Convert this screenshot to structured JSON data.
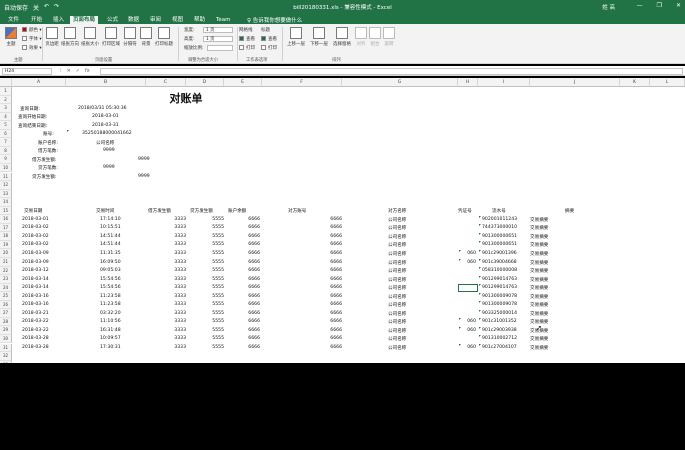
{
  "titlebar": {
    "quick_access": [
      "自动保存",
      "关",
      "↶",
      "↷"
    ],
    "title": "bill20180331.xls - 兼容性模式 - Excel",
    "user": "姓 高",
    "window_buttons": [
      "—",
      "❐",
      "✕"
    ]
  },
  "tabs": [
    "文件",
    "开始",
    "插入",
    "页面布局",
    "公式",
    "数据",
    "审阅",
    "视图",
    "帮助",
    "Team"
  ],
  "active_tab": "页面布局",
  "tellme": "♀ 告诉我你想要做什么",
  "share": "",
  "ribbon": {
    "theme": {
      "theme": "主题",
      "colors": "颜色 ▾",
      "fonts": "字体 ▾",
      "effects": "效果 ▾",
      "label": "主题"
    },
    "page_setup": {
      "margins": "页边距",
      "orientation": "纸张方向",
      "size": "纸张大小",
      "print_area": "打印区域",
      "breaks": "分隔符",
      "background": "背景",
      "print_titles": "打印标题",
      "label": "页面设置"
    },
    "scale": {
      "width_label": "宽度:",
      "width_value": "1 页",
      "height_label": "高度:",
      "height_value": "1 页",
      "scale_label": "缩放比例:",
      "scale_value": "",
      "label": "调整为合适大小"
    },
    "sheet_options": {
      "gridlines": "网格线",
      "headings": "标题",
      "view": "查看",
      "print": "打印",
      "label": "工作表选项"
    },
    "arrange": {
      "bring_forward": "上移一层",
      "send_backward": "下移一层",
      "selection_pane": "选择窗格",
      "align": "对齐",
      "group": "组合",
      "rotate": "旋转",
      "label": "排列"
    }
  },
  "formula_bar": {
    "name_box": "H24",
    "icons": [
      "⁝",
      "✕",
      "✓",
      "fx"
    ],
    "value": ""
  },
  "columns": [
    "A",
    "B",
    "C",
    "D",
    "E",
    "F",
    "G",
    "H",
    "I",
    "J",
    "K",
    "L"
  ],
  "rows": [
    "1",
    "2",
    "3",
    "4",
    "5",
    "6",
    "7",
    "8",
    "9",
    "10",
    "11",
    "12",
    "13",
    "14",
    "15",
    "16",
    "17",
    "18",
    "19",
    "20",
    "21",
    "22",
    "23",
    "24",
    "25",
    "26",
    "27",
    "28",
    "29",
    "30",
    "31",
    "32",
    "33"
  ],
  "sheet_title": "对账单",
  "header_info": [
    {
      "label": "查询日期:",
      "value": "2018/03/31 05:30:36"
    },
    {
      "label": "查询开始日期:",
      "value": "2018-03-01"
    },
    {
      "label": "查询结束日期:",
      "value": "2018-03-31"
    },
    {
      "label": "账号:",
      "value": "35250188000041662"
    },
    {
      "label": "账户名称:",
      "value": "公司名称"
    },
    {
      "label": "借方笔数:",
      "value": "9999"
    },
    {
      "label": "借方发生额:",
      "value": "9999"
    },
    {
      "label": "贷方笔数:",
      "value": "9999"
    },
    {
      "label": "贷方发生额:",
      "value": "9999"
    }
  ],
  "table_headers": [
    "交易日期",
    "交易时间",
    "借方发生额",
    "贷方发生额",
    "账户余额",
    "对方账号",
    "对方名称",
    "凭证号",
    "流水号",
    "摘要"
  ],
  "table_rows": [
    {
      "date": "2018-03-01",
      "time": "17:14:10",
      "debit": "3333",
      "credit": "5555",
      "balance": "6666",
      "account": "6666",
      "name": "公司名称",
      "voucher": "",
      "serial": "902001011243",
      "summary": "交易摘要"
    },
    {
      "date": "2018-03-02",
      "time": "10:15:51",
      "debit": "3333",
      "credit": "5555",
      "balance": "6666",
      "account": "6666",
      "name": "公司名称",
      "voucher": "",
      "serial": "744373000010",
      "summary": "交易摘要"
    },
    {
      "date": "2018-03-02",
      "time": "14:51:44",
      "debit": "3333",
      "credit": "5555",
      "balance": "6666",
      "account": "6666",
      "name": "公司名称",
      "voucher": "",
      "serial": "901300000651",
      "summary": "交易摘要"
    },
    {
      "date": "2018-03-02",
      "time": "14:51:44",
      "debit": "3333",
      "credit": "5555",
      "balance": "6666",
      "account": "6666",
      "name": "公司名称",
      "voucher": "",
      "serial": "901300000651",
      "summary": "交易摘要"
    },
    {
      "date": "2018-03-09",
      "time": "11:31:35",
      "debit": "3333",
      "credit": "5555",
      "balance": "6666",
      "account": "6666",
      "name": "公司名称",
      "voucher": "060",
      "serial": "901c29001396",
      "summary": "交易摘要"
    },
    {
      "date": "2018-03-09",
      "time": "16:09:50",
      "debit": "3333",
      "credit": "5555",
      "balance": "6666",
      "account": "6666",
      "name": "公司名称",
      "voucher": "060",
      "serial": "901c39004668",
      "summary": "交易摘要"
    },
    {
      "date": "2018-03-12",
      "time": "09:05:03",
      "debit": "3333",
      "credit": "5555",
      "balance": "6666",
      "account": "6666",
      "name": "公司名称",
      "voucher": "",
      "serial": "058310000008",
      "summary": "交易摘要"
    },
    {
      "date": "2018-03-14",
      "time": "15:54:56",
      "debit": "3333",
      "credit": "5555",
      "balance": "6666",
      "account": "6666",
      "name": "公司名称",
      "voucher": "",
      "serial": "901299014763",
      "summary": "交易摘要"
    },
    {
      "date": "2018-03-14",
      "time": "15:54:56",
      "debit": "3333",
      "credit": "5555",
      "balance": "6666",
      "account": "6666",
      "name": "公司名称",
      "voucher": "",
      "serial": "901299014763",
      "summary": "交易摘要"
    },
    {
      "date": "2018-03-16",
      "time": "11:23:58",
      "debit": "3333",
      "credit": "5555",
      "balance": "6666",
      "account": "6666",
      "name": "公司名称",
      "voucher": "",
      "serial": "901300009078",
      "summary": "交易摘要"
    },
    {
      "date": "2018-03-16",
      "time": "11:23:58",
      "debit": "3333",
      "credit": "5555",
      "balance": "6666",
      "account": "6666",
      "name": "公司名称",
      "voucher": "",
      "serial": "901300009078",
      "summary": "交易摘要"
    },
    {
      "date": "2018-03-21",
      "time": "03:32:20",
      "debit": "3333",
      "credit": "5555",
      "balance": "6666",
      "account": "6666",
      "name": "公司名称",
      "voucher": "",
      "serial": "903325000014",
      "summary": "交易摘要"
    },
    {
      "date": "2018-03-22",
      "time": "11:10:56",
      "debit": "3333",
      "credit": "5555",
      "balance": "6666",
      "account": "6666",
      "name": "公司名称",
      "voucher": "060",
      "serial": "901c31001352",
      "summary": "交易摘要"
    },
    {
      "date": "2018-03-22",
      "time": "16:31:48",
      "debit": "3333",
      "credit": "5555",
      "balance": "6666",
      "account": "6666",
      "name": "公司名称",
      "voucher": "060",
      "serial": "901c29003938",
      "summary": "交易摘要"
    },
    {
      "date": "2018-03-28",
      "time": "10:09:57",
      "debit": "3333",
      "credit": "5555",
      "balance": "6666",
      "account": "6666",
      "name": "公司名称",
      "voucher": "",
      "serial": "901310002712",
      "summary": "交易摘要"
    },
    {
      "date": "2018-03-28",
      "time": "17:30:31",
      "debit": "3333",
      "credit": "5555",
      "balance": "6666",
      "account": "6666",
      "name": "公司名称",
      "voucher": "060",
      "serial": "901c27004107",
      "summary": "交易摘要"
    }
  ],
  "colors": {
    "excel_green": "#217346",
    "ribbon_bg": "#f3f3f3",
    "header_bg": "#f3f3f3",
    "grid": "#e4e4e4"
  },
  "icons": {
    "cursor": "arrow-cursor"
  }
}
